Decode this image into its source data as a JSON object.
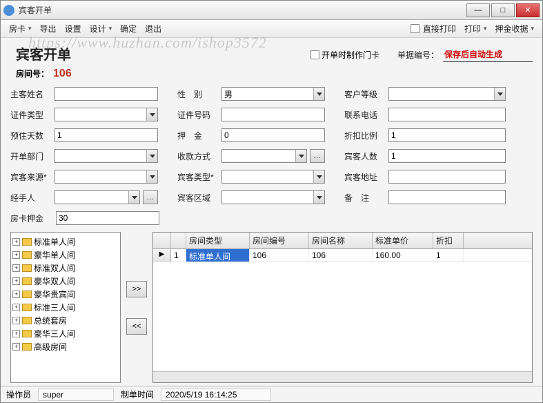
{
  "window_title": "宾客开单",
  "menu": {
    "items": [
      "房卡",
      "导出",
      "设置",
      "设计",
      "确定",
      "退出"
    ],
    "print_direct": "直接打印",
    "print": "打印",
    "deposit": "押金收据"
  },
  "header": {
    "title": "宾客开单",
    "make_card_chk": "开单时制作门卡",
    "order_no_label": "单据编号：",
    "order_no_value": "保存后自动生成",
    "room_label": "房间号：",
    "room_value": "106"
  },
  "form": {
    "r1": {
      "l1": "主客姓名",
      "v1": "",
      "l2": "性　别",
      "v2": "男",
      "l3": "客户等级",
      "v3": ""
    },
    "r2": {
      "l1": "证件类型",
      "v1": "",
      "l2": "证件号码",
      "v2": "",
      "l3": "联系电话",
      "v3": ""
    },
    "r3": {
      "l1": "预住天数",
      "v1": "1",
      "l2": "押　金",
      "v2": "0",
      "l3": "折扣比例",
      "v3": "1"
    },
    "r4": {
      "l1": "开单部门",
      "v1": "",
      "l2": "收款方式",
      "v2": "",
      "l3": "宾客人数",
      "v3": "1"
    },
    "r5": {
      "l1": "宾客来源*",
      "v1": "",
      "l2": "宾客类型*",
      "v2": "",
      "l3": "宾客地址",
      "v3": ""
    },
    "r6": {
      "l1": "经手人",
      "v1": "",
      "l2": "宾客区域",
      "v2": "",
      "l3": "备　注",
      "v3": ""
    },
    "extra": {
      "label": "房卡押金",
      "value": "30"
    }
  },
  "tree": [
    "标准单人间",
    "豪华单人间",
    "标准双人间",
    "豪华双人间",
    "豪华贵宾间",
    "标准三人间",
    "总统套房",
    "豪华三人间",
    "高级房间"
  ],
  "table": {
    "cols": [
      "",
      "",
      "房间类型",
      "房间编号",
      "房间名称",
      "标准单价",
      "折扣"
    ],
    "row": {
      "idx": "1",
      "type": "标准单人间",
      "no": "106",
      "name": "106",
      "price": "160.00",
      "disc": "1"
    }
  },
  "status": {
    "op_label": "操作员",
    "op_value": "super",
    "time_label": "制单时间",
    "time_value": "2020/5/19 16:14:25"
  },
  "watermark": "https://www.huzhan.com/ishop3572"
}
